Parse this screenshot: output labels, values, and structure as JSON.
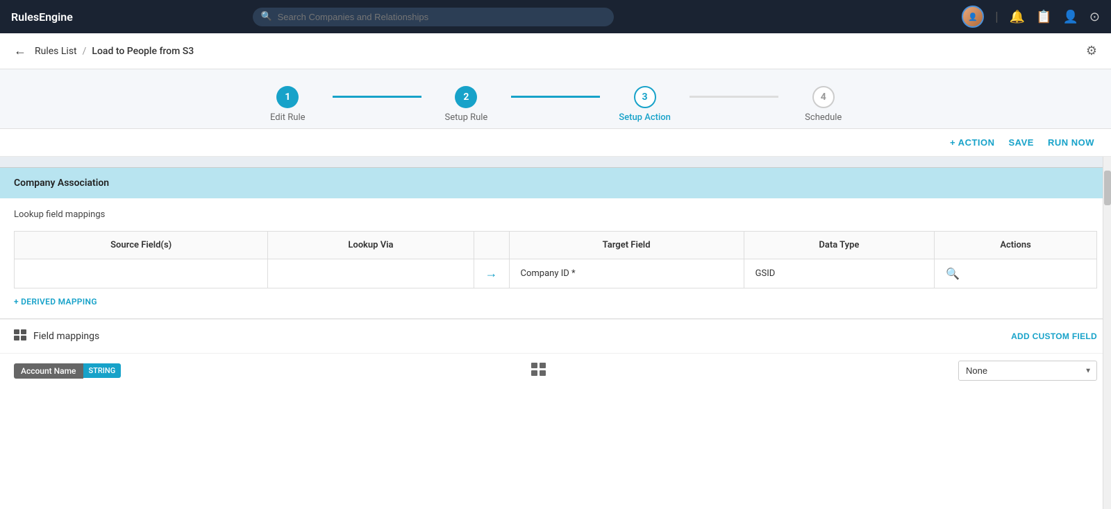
{
  "app": {
    "brand": "RulesEngine",
    "search_placeholder": "Search Companies and Relationships"
  },
  "breadcrumb": {
    "back_label": "←",
    "rules_list": "Rules List",
    "separator": "/",
    "current": "Load to People from S3"
  },
  "stepper": {
    "steps": [
      {
        "number": "1",
        "label": "Edit Rule",
        "state": "completed"
      },
      {
        "number": "2",
        "label": "Setup Rule",
        "state": "completed"
      },
      {
        "number": "3",
        "label": "Setup Action",
        "state": "active"
      },
      {
        "number": "4",
        "label": "Schedule",
        "state": "inactive"
      }
    ]
  },
  "actions": {
    "add_action": "+ ACTION",
    "save": "SAVE",
    "run_now": "RUN NOW"
  },
  "company_association": {
    "section_title": "Company Association",
    "lookup_label": "Lookup field mappings",
    "table": {
      "headers": [
        "Source Field(s)",
        "Lookup Via",
        "",
        "Target Field",
        "Data Type",
        "Actions"
      ],
      "rows": [
        {
          "source": "",
          "lookup_via": "",
          "target": "Company ID *",
          "data_type": "GSID"
        }
      ]
    },
    "derived_mapping_link": "+ DERIVED MAPPING"
  },
  "field_mappings": {
    "title": "Field mappings",
    "add_custom_field": "ADD CUSTOM FIELD",
    "rows": [
      {
        "field_name": "Account Name",
        "field_type": "STRING",
        "select_value": "None"
      }
    ]
  },
  "icons": {
    "search": "🔍",
    "bell": "🔔",
    "bookmark": "📋",
    "user_icon": "👤",
    "gear": "⚙",
    "arrow_right": "→",
    "field_mapping_icon": "⊞"
  }
}
